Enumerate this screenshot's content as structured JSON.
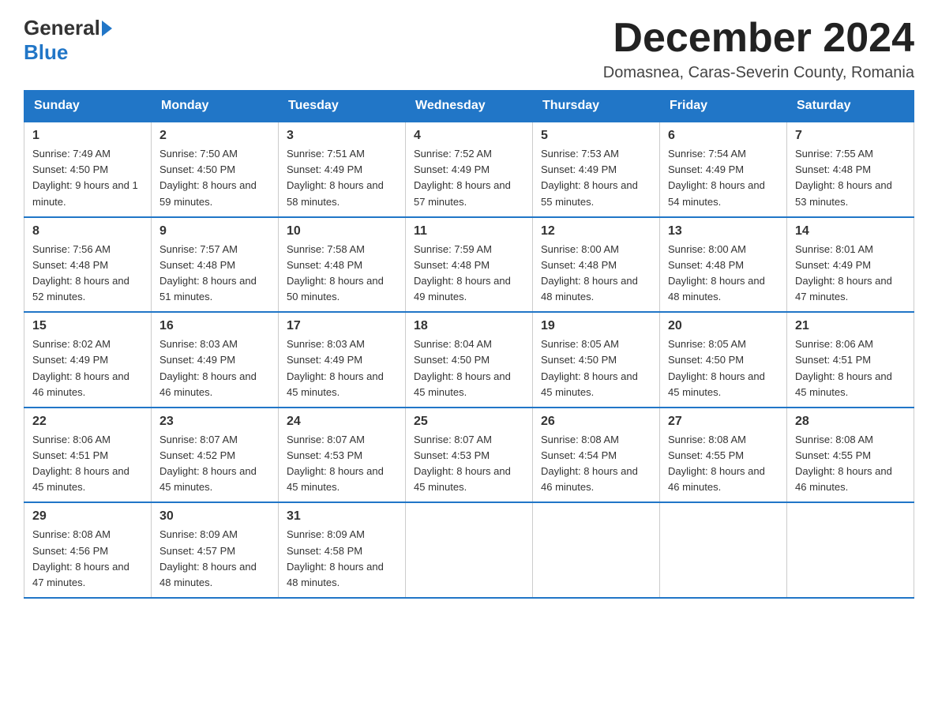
{
  "header": {
    "logo_general": "General",
    "logo_blue": "Blue",
    "month_year": "December 2024",
    "location": "Domasnea, Caras-Severin County, Romania"
  },
  "days_of_week": [
    "Sunday",
    "Monday",
    "Tuesday",
    "Wednesday",
    "Thursday",
    "Friday",
    "Saturday"
  ],
  "weeks": [
    [
      {
        "day": "1",
        "sunrise": "7:49 AM",
        "sunset": "4:50 PM",
        "daylight": "9 hours and 1 minute."
      },
      {
        "day": "2",
        "sunrise": "7:50 AM",
        "sunset": "4:50 PM",
        "daylight": "8 hours and 59 minutes."
      },
      {
        "day": "3",
        "sunrise": "7:51 AM",
        "sunset": "4:49 PM",
        "daylight": "8 hours and 58 minutes."
      },
      {
        "day": "4",
        "sunrise": "7:52 AM",
        "sunset": "4:49 PM",
        "daylight": "8 hours and 57 minutes."
      },
      {
        "day": "5",
        "sunrise": "7:53 AM",
        "sunset": "4:49 PM",
        "daylight": "8 hours and 55 minutes."
      },
      {
        "day": "6",
        "sunrise": "7:54 AM",
        "sunset": "4:49 PM",
        "daylight": "8 hours and 54 minutes."
      },
      {
        "day": "7",
        "sunrise": "7:55 AM",
        "sunset": "4:48 PM",
        "daylight": "8 hours and 53 minutes."
      }
    ],
    [
      {
        "day": "8",
        "sunrise": "7:56 AM",
        "sunset": "4:48 PM",
        "daylight": "8 hours and 52 minutes."
      },
      {
        "day": "9",
        "sunrise": "7:57 AM",
        "sunset": "4:48 PM",
        "daylight": "8 hours and 51 minutes."
      },
      {
        "day": "10",
        "sunrise": "7:58 AM",
        "sunset": "4:48 PM",
        "daylight": "8 hours and 50 minutes."
      },
      {
        "day": "11",
        "sunrise": "7:59 AM",
        "sunset": "4:48 PM",
        "daylight": "8 hours and 49 minutes."
      },
      {
        "day": "12",
        "sunrise": "8:00 AM",
        "sunset": "4:48 PM",
        "daylight": "8 hours and 48 minutes."
      },
      {
        "day": "13",
        "sunrise": "8:00 AM",
        "sunset": "4:48 PM",
        "daylight": "8 hours and 48 minutes."
      },
      {
        "day": "14",
        "sunrise": "8:01 AM",
        "sunset": "4:49 PM",
        "daylight": "8 hours and 47 minutes."
      }
    ],
    [
      {
        "day": "15",
        "sunrise": "8:02 AM",
        "sunset": "4:49 PM",
        "daylight": "8 hours and 46 minutes."
      },
      {
        "day": "16",
        "sunrise": "8:03 AM",
        "sunset": "4:49 PM",
        "daylight": "8 hours and 46 minutes."
      },
      {
        "day": "17",
        "sunrise": "8:03 AM",
        "sunset": "4:49 PM",
        "daylight": "8 hours and 45 minutes."
      },
      {
        "day": "18",
        "sunrise": "8:04 AM",
        "sunset": "4:50 PM",
        "daylight": "8 hours and 45 minutes."
      },
      {
        "day": "19",
        "sunrise": "8:05 AM",
        "sunset": "4:50 PM",
        "daylight": "8 hours and 45 minutes."
      },
      {
        "day": "20",
        "sunrise": "8:05 AM",
        "sunset": "4:50 PM",
        "daylight": "8 hours and 45 minutes."
      },
      {
        "day": "21",
        "sunrise": "8:06 AM",
        "sunset": "4:51 PM",
        "daylight": "8 hours and 45 minutes."
      }
    ],
    [
      {
        "day": "22",
        "sunrise": "8:06 AM",
        "sunset": "4:51 PM",
        "daylight": "8 hours and 45 minutes."
      },
      {
        "day": "23",
        "sunrise": "8:07 AM",
        "sunset": "4:52 PM",
        "daylight": "8 hours and 45 minutes."
      },
      {
        "day": "24",
        "sunrise": "8:07 AM",
        "sunset": "4:53 PM",
        "daylight": "8 hours and 45 minutes."
      },
      {
        "day": "25",
        "sunrise": "8:07 AM",
        "sunset": "4:53 PM",
        "daylight": "8 hours and 45 minutes."
      },
      {
        "day": "26",
        "sunrise": "8:08 AM",
        "sunset": "4:54 PM",
        "daylight": "8 hours and 46 minutes."
      },
      {
        "day": "27",
        "sunrise": "8:08 AM",
        "sunset": "4:55 PM",
        "daylight": "8 hours and 46 minutes."
      },
      {
        "day": "28",
        "sunrise": "8:08 AM",
        "sunset": "4:55 PM",
        "daylight": "8 hours and 46 minutes."
      }
    ],
    [
      {
        "day": "29",
        "sunrise": "8:08 AM",
        "sunset": "4:56 PM",
        "daylight": "8 hours and 47 minutes."
      },
      {
        "day": "30",
        "sunrise": "8:09 AM",
        "sunset": "4:57 PM",
        "daylight": "8 hours and 48 minutes."
      },
      {
        "day": "31",
        "sunrise": "8:09 AM",
        "sunset": "4:58 PM",
        "daylight": "8 hours and 48 minutes."
      },
      null,
      null,
      null,
      null
    ]
  ]
}
